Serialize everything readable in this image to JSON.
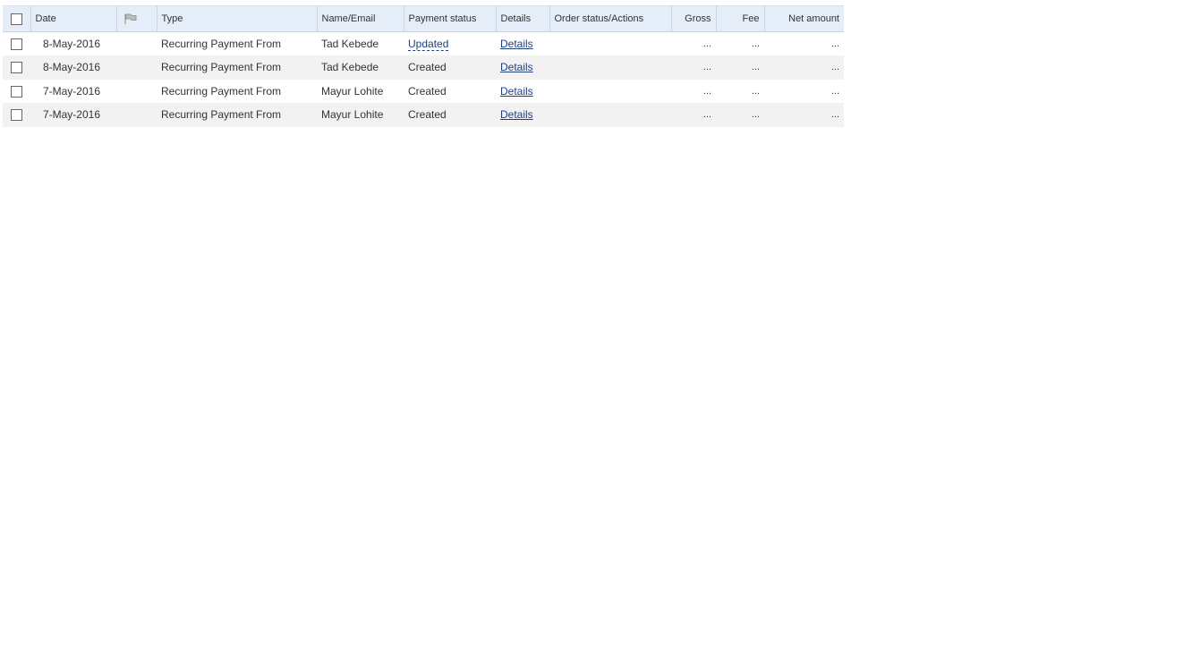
{
  "table": {
    "headers": {
      "date": "Date",
      "flag": "flag-icon",
      "type": "Type",
      "name": "Name/Email",
      "payment_status": "Payment status",
      "details": "Details",
      "order_status": "Order status/Actions",
      "gross": "Gross",
      "fee": "Fee",
      "net": "Net amount"
    },
    "rows": [
      {
        "date": "8-May-2016",
        "type": "Recurring Payment From",
        "name": "Tad Kebede",
        "status": "Updated",
        "details": "Details",
        "gross": "...",
        "fee": "...",
        "net": "..."
      },
      {
        "date": "8-May-2016",
        "type": "Recurring Payment From",
        "name": "Tad Kebede",
        "status": "Created",
        "details": "Details",
        "gross": "...",
        "fee": "...",
        "net": "..."
      },
      {
        "date": "7-May-2016",
        "type": "Recurring Payment From",
        "name": "Mayur Lohite",
        "status": "Created",
        "details": "Details",
        "gross": "...",
        "fee": "...",
        "net": "..."
      },
      {
        "date": "7-May-2016",
        "type": "Recurring Payment From",
        "name": "Mayur Lohite",
        "status": "Created",
        "details": "Details",
        "gross": "...",
        "fee": "...",
        "net": "..."
      }
    ]
  },
  "colors": {
    "header_bg": "#e4edf8",
    "alt_row_bg": "#f2f2f2",
    "link": "#1f3f7f"
  }
}
